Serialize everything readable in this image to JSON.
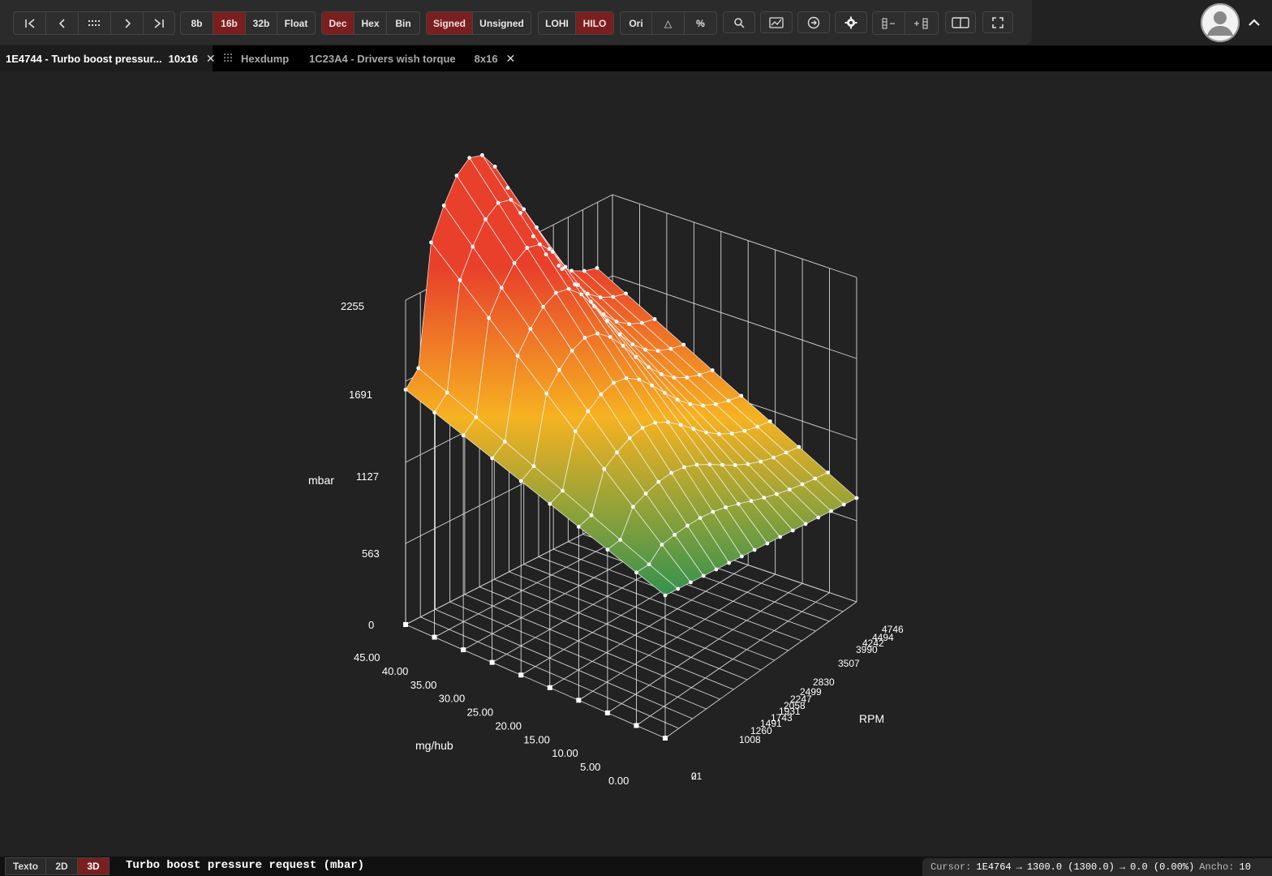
{
  "toolbar": {
    "width_buttons": [
      {
        "label": "8b",
        "active": false
      },
      {
        "label": "16b",
        "active": true
      },
      {
        "label": "32b",
        "active": false
      },
      {
        "label": "Float",
        "active": false
      }
    ],
    "base_buttons": [
      {
        "label": "Dec",
        "active": true
      },
      {
        "label": "Hex",
        "active": false
      },
      {
        "label": "Bin",
        "active": false
      }
    ],
    "sign_buttons": [
      {
        "label": "Signed",
        "active": true
      },
      {
        "label": "Unsigned",
        "active": false
      }
    ],
    "endian_buttons": [
      {
        "label": "LOHI",
        "active": false
      },
      {
        "label": "HILO",
        "active": true
      }
    ],
    "value_buttons": [
      {
        "label": "Ori"
      },
      {
        "label": "△"
      },
      {
        "label": "%"
      }
    ],
    "accent_color": "#7a1f1f"
  },
  "tabs": [
    {
      "label": "1E4744 - Turbo boost pressur...",
      "size": "10x16",
      "active": true,
      "closable": true
    },
    {
      "label": "Hexdump",
      "icon": "grid-icon",
      "active": false
    },
    {
      "label": "1C23A4 - Drivers wish torque",
      "size": "8x16",
      "active": false,
      "closable": true
    }
  ],
  "chart_data": {
    "type": "surface",
    "title": "",
    "zlabel": "mbar",
    "xlabel": "mg/hub",
    "ylabel": "RPM",
    "z_ticks": [
      "2255",
      "1691",
      "1127",
      "563",
      "0"
    ],
    "x_ticks": [
      "45.00",
      "40.00",
      "35.00",
      "30.00",
      "25.00",
      "20.00",
      "15.00",
      "10.00",
      "5.00",
      "0.00"
    ],
    "y_ticks": [
      "4746",
      "4494",
      "4242",
      "3990",
      "3507",
      "2830",
      "2499",
      "2247",
      "2058",
      "1931",
      "1743",
      "1491",
      "1260",
      "1008",
      "21",
      "0"
    ],
    "colorscale": [
      "#2e9150",
      "#f6b221",
      "#e8402b"
    ]
  },
  "statusbar": {
    "views": [
      {
        "label": "Texto",
        "active": false
      },
      {
        "label": "2D",
        "active": false
      },
      {
        "label": "3D",
        "active": true
      }
    ],
    "map_description": "Turbo boost pressure request (mbar)",
    "cursor_label": "Cursor:",
    "cursor_address": "1E4764",
    "cursor_value": "1300.0 (1300.0)",
    "cursor_delta": "0.0 (0.00%)",
    "width_label": "Ancho:",
    "width_value": "10"
  }
}
